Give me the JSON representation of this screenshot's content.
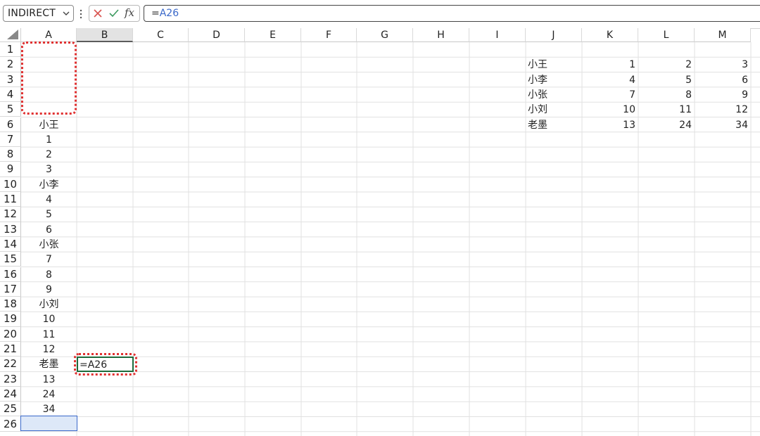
{
  "formula_bar": {
    "name_box": "INDIRECT",
    "cancel_icon": "x-icon",
    "enter_icon": "check-icon",
    "insert_function_label": "fx",
    "formula_prefix": "=",
    "formula_ref": "A26"
  },
  "columns": [
    "A",
    "B",
    "C",
    "D",
    "E",
    "F",
    "G",
    "H",
    "I",
    "J",
    "K",
    "L",
    "M"
  ],
  "rows": [
    "1",
    "2",
    "3",
    "4",
    "5",
    "6",
    "7",
    "8",
    "9",
    "10",
    "11",
    "12",
    "13",
    "14",
    "15",
    "16",
    "17",
    "18",
    "19",
    "20",
    "21",
    "22",
    "23",
    "24",
    "25",
    "26"
  ],
  "colA": [
    "",
    "",
    "",
    "",
    "",
    "小王",
    "1",
    "2",
    "3",
    "小李",
    "4",
    "5",
    "6",
    "小张",
    "7",
    "8",
    "9",
    "小刘",
    "10",
    "11",
    "12",
    "老墨",
    "13",
    "24",
    "34",
    ""
  ],
  "table": [
    {
      "name": "小王",
      "k": "1",
      "l": "2",
      "m": "3"
    },
    {
      "name": "小李",
      "k": "4",
      "l": "5",
      "m": "6"
    },
    {
      "name": "小张",
      "k": "7",
      "l": "8",
      "m": "9"
    },
    {
      "name": "小刘",
      "k": "10",
      "l": "11",
      "m": "12"
    },
    {
      "name": "老墨",
      "k": "13",
      "l": "24",
      "m": "34"
    }
  ],
  "active_cell": {
    "address": "B22",
    "content": "=A26"
  },
  "colors": {
    "active_border": "#1e6b3c",
    "highlight_dotted": "#e03131",
    "reference_border": "#3a68c9"
  }
}
